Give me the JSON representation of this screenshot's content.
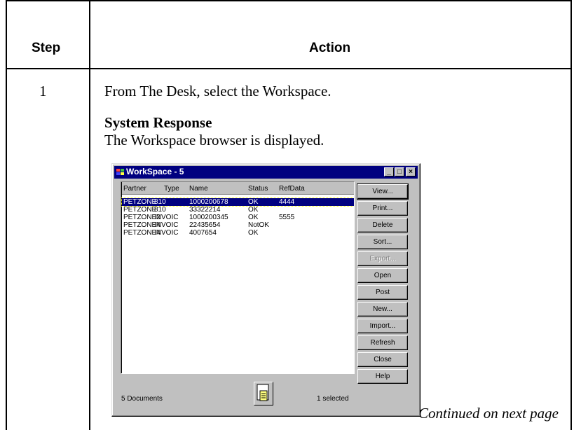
{
  "table": {
    "header_step": "Step",
    "header_action": "Action",
    "step_number": "1",
    "instruction": "From The Desk, select the Workspace.",
    "response_heading": "System Response",
    "response_text": "The Workspace browser is displayed.",
    "continued": "Continued on next page"
  },
  "window": {
    "title": "WorkSpace - 5",
    "columns": [
      "Partner",
      "Type",
      "Name",
      "Status",
      "RefData"
    ],
    "rows": [
      {
        "partner": "PETZONE",
        "type": "810",
        "name": "1000200678",
        "status": "OK",
        "refdata": "4444",
        "selected": true
      },
      {
        "partner": "PETZONE",
        "type": "810",
        "name": "33322214",
        "status": "OK",
        "refdata": "",
        "selected": false
      },
      {
        "partner": "PETZONE2",
        "type": "INVOIC",
        "name": "1000200345",
        "status": "OK",
        "refdata": "5555",
        "selected": false
      },
      {
        "partner": "PETZONE4",
        "type": "INVOIC",
        "name": "22435654",
        "status": "NotOK",
        "refdata": "",
        "selected": false
      },
      {
        "partner": "PETZONE4",
        "type": "INVOIC",
        "name": "4007654",
        "status": "OK",
        "refdata": "",
        "selected": false
      }
    ],
    "buttons": {
      "view": "View...",
      "print": "Print...",
      "delete": "Delete",
      "sort": "Sort...",
      "export": "Export...",
      "open": "Open",
      "post": "Post",
      "new": "New...",
      "import": "Import...",
      "refresh": "Refresh",
      "close": "Close",
      "help": "Help"
    },
    "status_left": "5 Documents",
    "status_right": "1 selected",
    "title_icon": "workspace-app-icon",
    "doc_icon": "document-icon",
    "colors": {
      "titlebar": "#000080",
      "face": "#c0c0c0",
      "selection": "#000080"
    }
  }
}
